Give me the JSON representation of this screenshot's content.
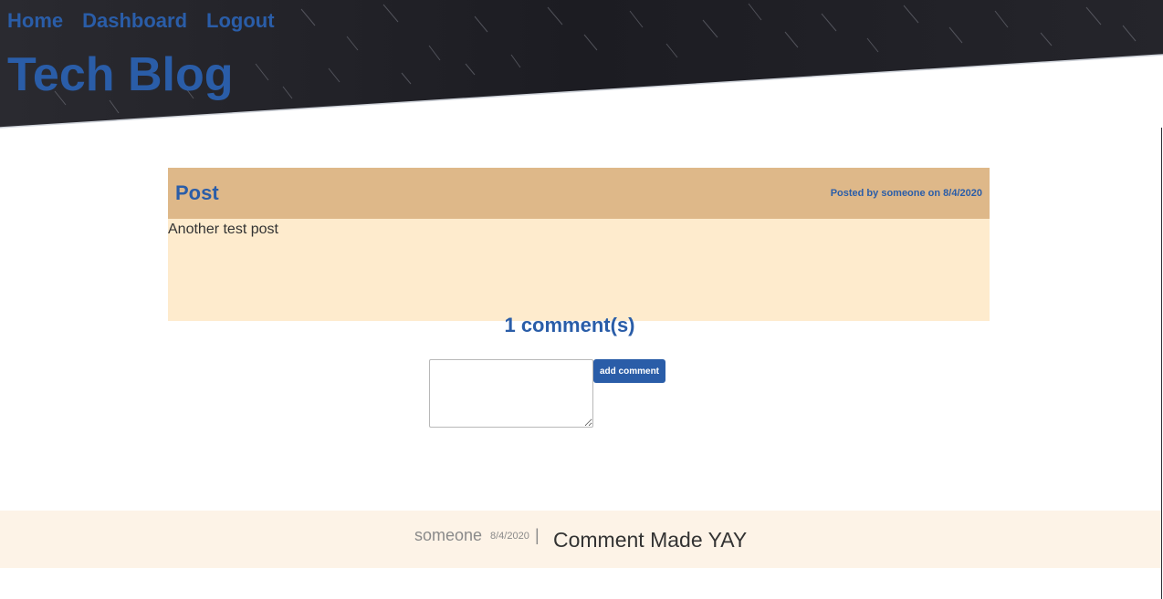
{
  "nav": {
    "home": "Home",
    "dashboard": "Dashboard",
    "logout": "Logout"
  },
  "site": {
    "title": "Tech Blog"
  },
  "post": {
    "title": "Post",
    "meta": "Posted by someone on 8/4/2020",
    "body": "Another test post"
  },
  "comments": {
    "count_label": "1 comment(s)",
    "textarea_value": "",
    "add_button_label": "add comment",
    "items": [
      {
        "author": "someone",
        "date": "8/4/2020",
        "separator": "|",
        "text": "Comment Made YAY"
      }
    ]
  },
  "colors": {
    "accent": "#2a5da8",
    "post_header": "#deb889",
    "post_body": "#feebcd",
    "comment_bg": "#fdf3e7",
    "hero_bg": "#1c1c22"
  }
}
